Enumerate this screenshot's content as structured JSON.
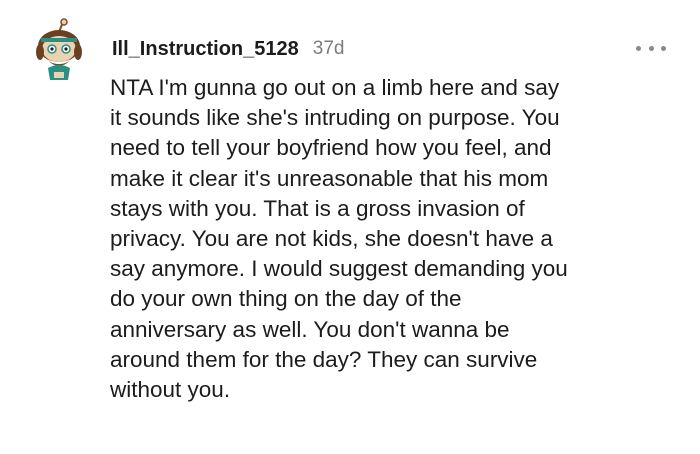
{
  "comment": {
    "username": "Ill_Instruction_5128",
    "age": "37d",
    "body_lines": [
      "NTA I'm gunna go out on a limb here and say",
      "it sounds like she's intruding on purpose. You",
      "need to tell your boyfriend how you feel, and",
      "make it clear it's unreasonable that his mom",
      "stays with you. That is a gross invasion of",
      "privacy. You are not kids, she doesn't have a",
      "say anymore. I would suggest demanding you",
      "do your own thing on the day of the",
      "anniversary as well. You don't wanna be",
      "around them for the day? They can survive",
      "without you."
    ],
    "more_icon": "more-horizontal-icon",
    "avatar_icon": "snoo-avatar-icon"
  },
  "colors": {
    "text": "#1c1c1c",
    "meta": "#7c7c7c",
    "icon": "#878a8c",
    "avatar_skin": "#e9d3b0",
    "avatar_hair": "#7a4a2a",
    "avatar_accent": "#2c8f84"
  }
}
